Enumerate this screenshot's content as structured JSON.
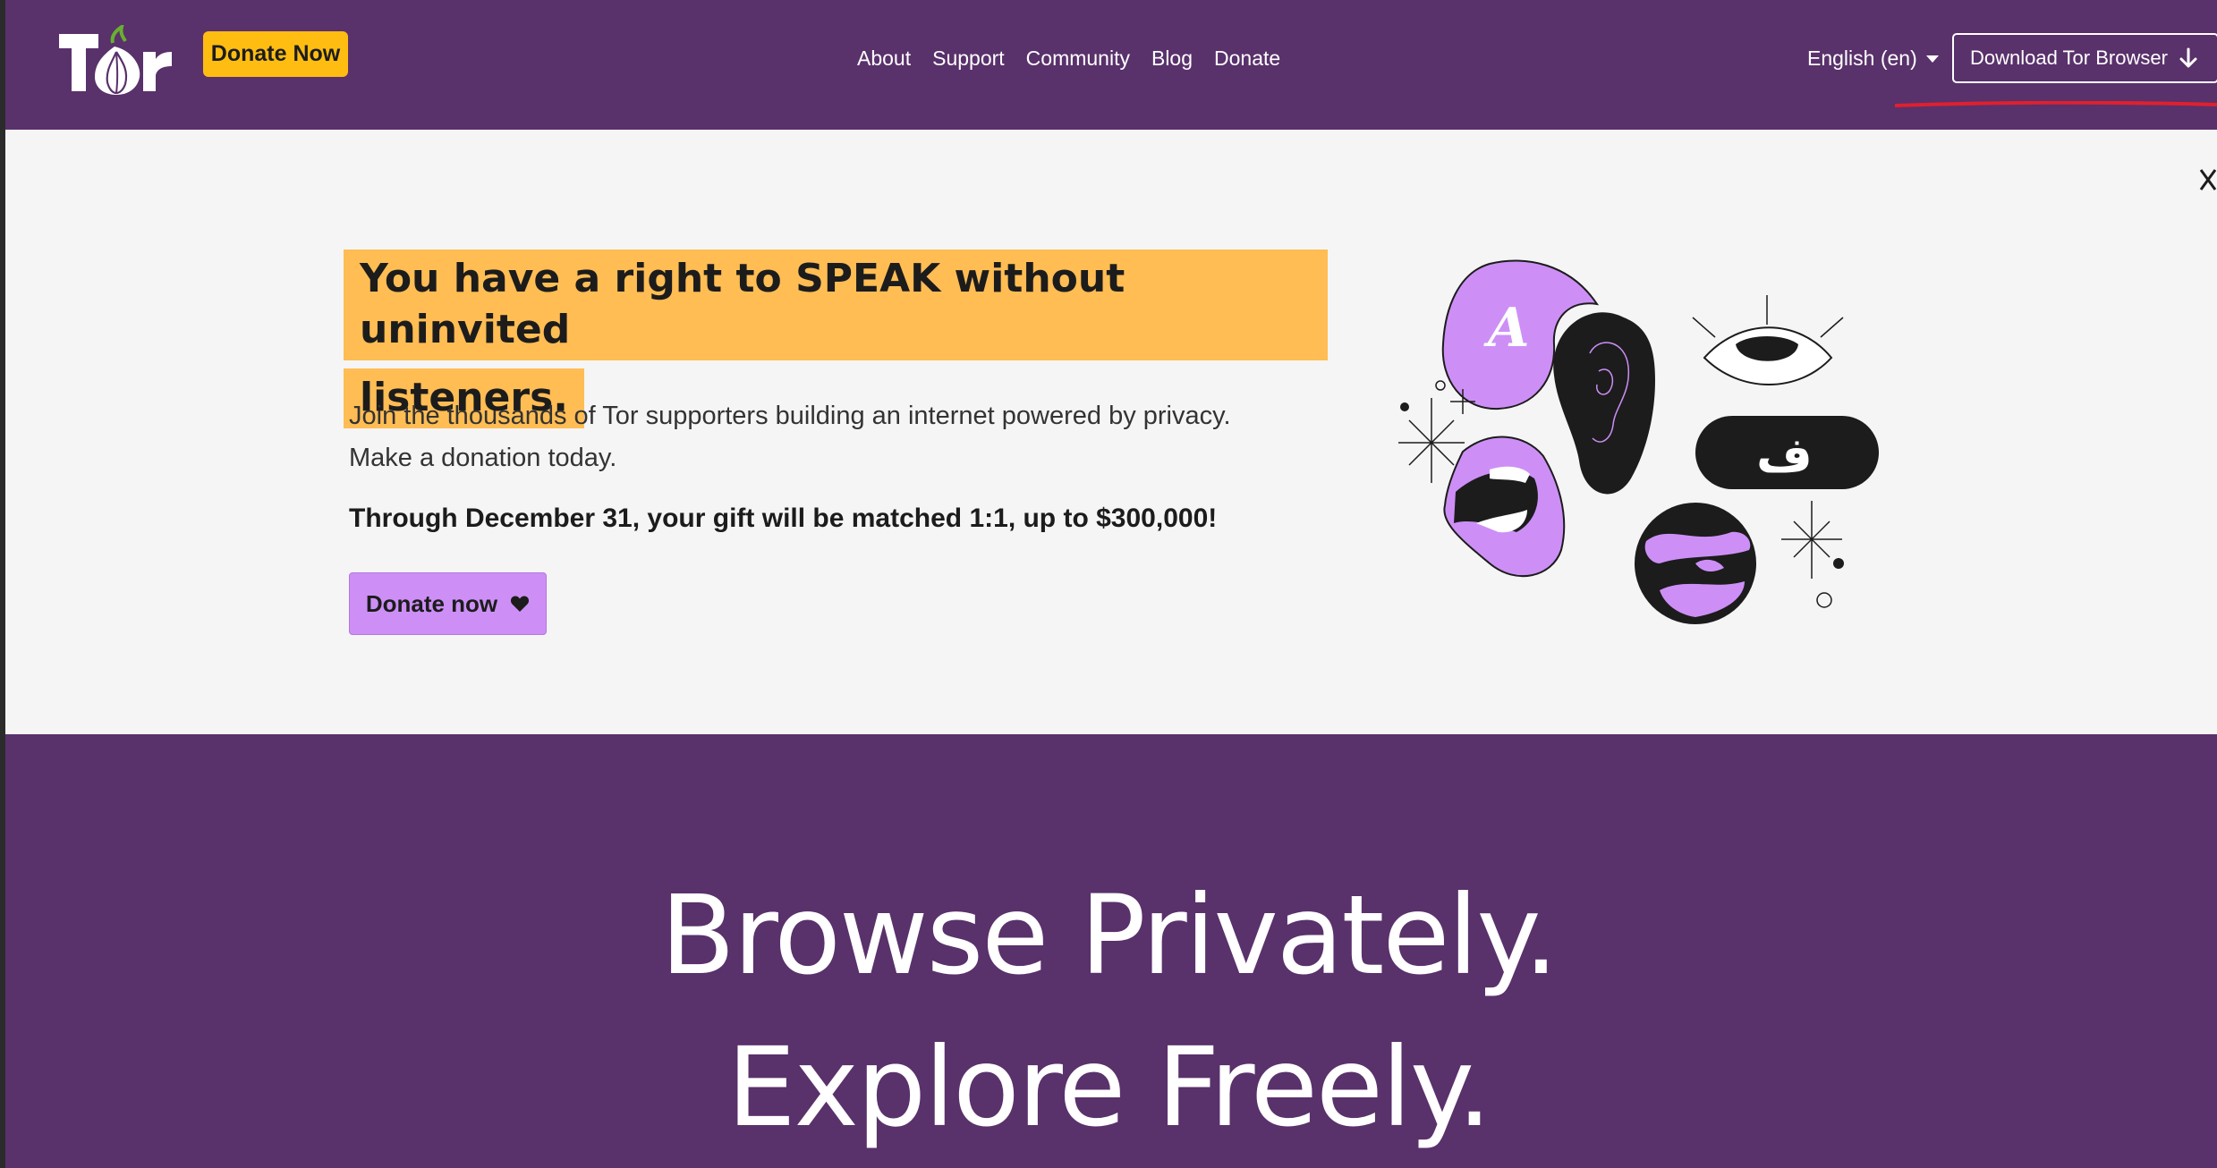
{
  "header": {
    "logo_text": "Tor",
    "donate_pill": "Donate Now",
    "nav": [
      "About",
      "Support",
      "Community",
      "Blog",
      "Donate"
    ],
    "language": "English (en)",
    "download_button": "Download Tor Browser"
  },
  "banner": {
    "headline_line1": "You have a right to SPEAK without uninvited",
    "headline_line2": "listeners.",
    "body_line1": "Join the thousands of Tor supporters building an internet powered by privacy.",
    "body_line2": "Make a donation today.",
    "match_text": "Through December 31, your gift will be matched 1:1, up to $300,000!",
    "donate_button": "Donate now",
    "illustration_badge_letter": "A",
    "illustration_pill_glyph": "ف"
  },
  "hero": {
    "line1": "Browse Privately.",
    "line2": "Explore Freely."
  },
  "colors": {
    "purple": "#59316b",
    "yellow": "#ffbd11",
    "highlight": "#ffbd54",
    "lavender": "#cd8ff6",
    "banner_bg": "#f5f5f5"
  },
  "icons": {
    "logo": "tor-onion-logo",
    "caret": "caret-down-icon",
    "download": "arrow-down-icon",
    "close": "close-icon",
    "heart": "heart-icon"
  }
}
